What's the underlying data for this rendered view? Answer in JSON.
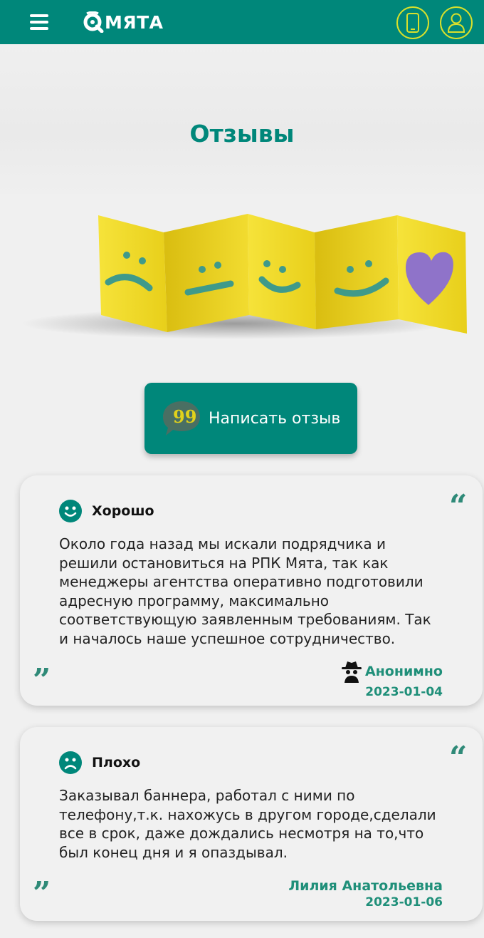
{
  "header": {
    "logo_text": "МЯТА",
    "accent_color": "#00877a",
    "icons": [
      "menu-icon",
      "phone-icon",
      "user-icon"
    ]
  },
  "page": {
    "title": "Отзывы"
  },
  "write_review": {
    "label": "Написать отзыв"
  },
  "reviews": [
    {
      "rating_label": "Хорошо",
      "rating_icon": "smile-icon",
      "text": "Около года назад мы искали подрядчика и решили остановиться на РПК Мята, так как менеджеры агентства оперативно подготовили адресную программу, максимально соответствующую заявленным требованиям. Так и началось наше успешное сотрудничество.",
      "author": "Анонимно",
      "author_icon": "anonymous-icon",
      "date": "2023-01-04"
    },
    {
      "rating_label": "Плохо",
      "rating_icon": "frown-icon",
      "text": "Заказывал баннера, работал с ними по телефону,т.к. нахожусь в другом городе,сделали все в срок, даже дождались несмотря на то,что был конец дня и я опаздывал.",
      "author": "Лилия Анатольевна",
      "date": "2023-01-06"
    }
  ]
}
